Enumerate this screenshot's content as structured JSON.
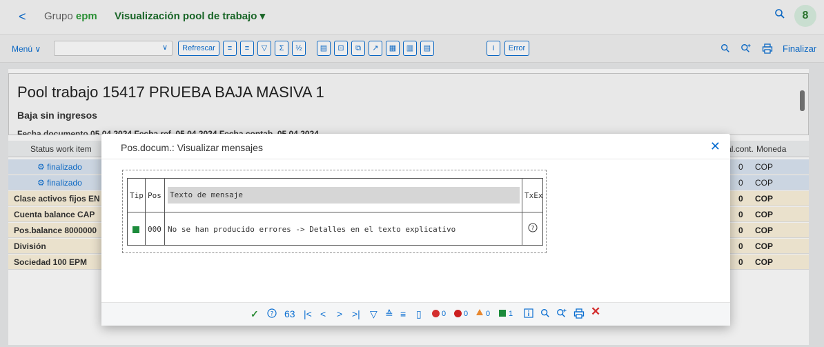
{
  "shell": {
    "back": "<",
    "brand_prefix": "Grupo ",
    "brand_mark": "epm",
    "title": "Visualización pool de trabajo ▾",
    "avatar": "8"
  },
  "toolbar": {
    "menu": "Menú ∨",
    "refresh": "Refrescar",
    "error": "Error",
    "finish": "Finalizar"
  },
  "header": {
    "title": "Pool trabajo 15417 PRUEBA BAJA MASIVA 1",
    "subtitle": "Baja sin ingresos",
    "meta": "Fecha documento 05.04.2024   Fecha ref. 05.04.2024   Fecha contab. 05.04.2024"
  },
  "table": {
    "col_status": "Status work item",
    "col_valcont": "Val.cont.",
    "col_currency": "Moneda",
    "rows": [
      {
        "status": "finalizado",
        "value": "0",
        "currency": "COP"
      },
      {
        "status": "finalizado",
        "value": "0",
        "currency": "COP"
      }
    ],
    "totals": [
      {
        "label": "Clase activos fijos EN",
        "value": "0",
        "currency": "COP"
      },
      {
        "label": "Cuenta balance CAP",
        "value": "0",
        "currency": "COP"
      },
      {
        "label": "Pos.balance 8000000",
        "value": "0",
        "currency": "COP"
      },
      {
        "label": "División",
        "value": "0",
        "currency": "COP"
      },
      {
        "label": "Sociedad 100 EPM",
        "value": "0",
        "currency": "COP"
      }
    ]
  },
  "dialog": {
    "title": "Pos.docum.: Visualizar mensajes",
    "columns": {
      "tip": "Tip",
      "pos": "Pos",
      "text": "Texto de mensaje",
      "txex": "TxEx"
    },
    "message": {
      "pos": "000",
      "text": "No se han producido errores -> Detalles en el texto explicativo"
    },
    "counts": {
      "stop": "0",
      "error": "0",
      "warning": "0",
      "success": "1"
    }
  },
  "colors": {
    "accent": "#0a6ed1",
    "brand_green": "#2e9b3a",
    "success": "#1c8b3b",
    "error": "#d32f2f",
    "warning": "#e8872e"
  }
}
